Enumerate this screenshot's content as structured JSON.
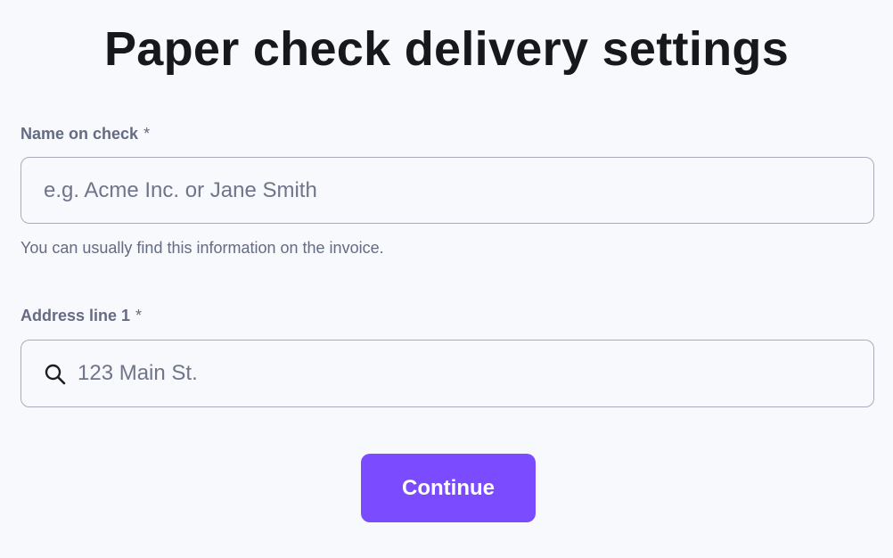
{
  "page": {
    "title": "Paper check delivery settings"
  },
  "name_field": {
    "label": "Name on check",
    "required_marker": "*",
    "placeholder": "e.g. Acme Inc. or Jane Smith",
    "value": "",
    "helper": "You can usually find this information on the invoice."
  },
  "address_field": {
    "label": "Address line 1",
    "required_marker": "*",
    "placeholder": "123 Main St.",
    "value": "",
    "icon": "search-icon"
  },
  "actions": {
    "continue_label": "Continue"
  },
  "colors": {
    "background": "#f8f9fc",
    "primary_button": "#7b4cff",
    "label_text": "#646b82",
    "input_border": "#a9adb9"
  }
}
